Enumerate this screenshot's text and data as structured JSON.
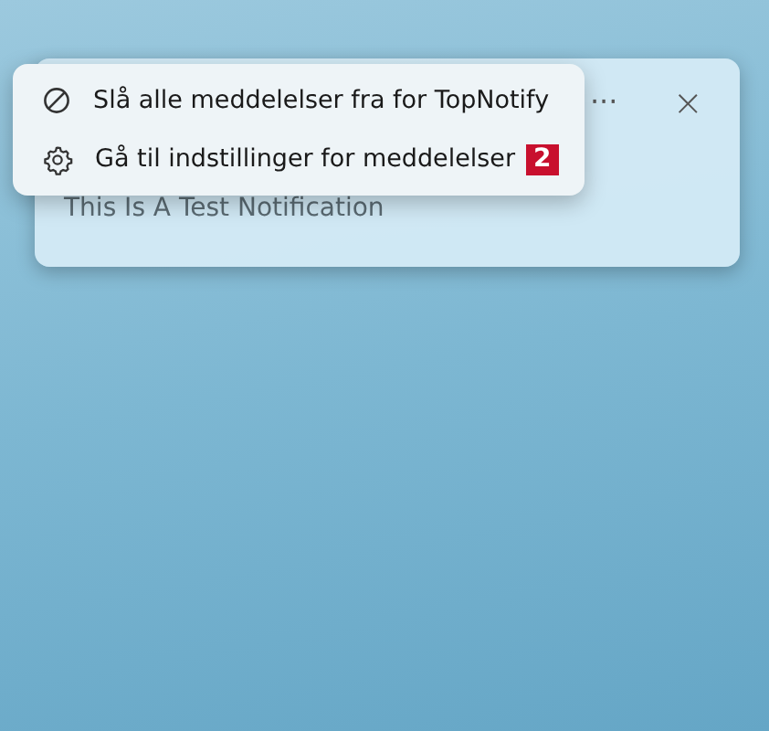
{
  "notification": {
    "more_button": "···",
    "close_button": "×",
    "message": "This Is A Test Notification"
  },
  "context_menu": {
    "items": [
      {
        "kind": "block",
        "label": "Slå alle meddelelser fra for TopNotify"
      },
      {
        "kind": "settings",
        "label": "Gå til indstillinger for meddelelser",
        "badge": "2"
      }
    ]
  }
}
